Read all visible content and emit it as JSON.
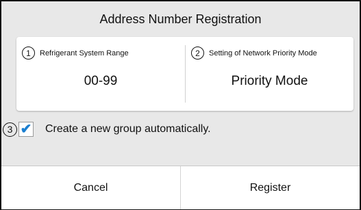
{
  "dialog": {
    "title": "Address Number Registration",
    "settings": [
      {
        "number": "1",
        "label": "Refrigerant System Range",
        "value": "00-99"
      },
      {
        "number": "2",
        "label": "Setting of Network Priority Mode",
        "value": "Priority Mode"
      }
    ],
    "auto_group": {
      "number": "3",
      "check_glyph": "✔",
      "checked": true,
      "label": "Create a new group automatically."
    },
    "buttons": {
      "cancel_label": "Cancel",
      "register_label": "Register"
    }
  },
  "colors": {
    "dialog_background": "#e8e8e8",
    "checkmark": "#1b7fd0",
    "border": "#111111"
  }
}
